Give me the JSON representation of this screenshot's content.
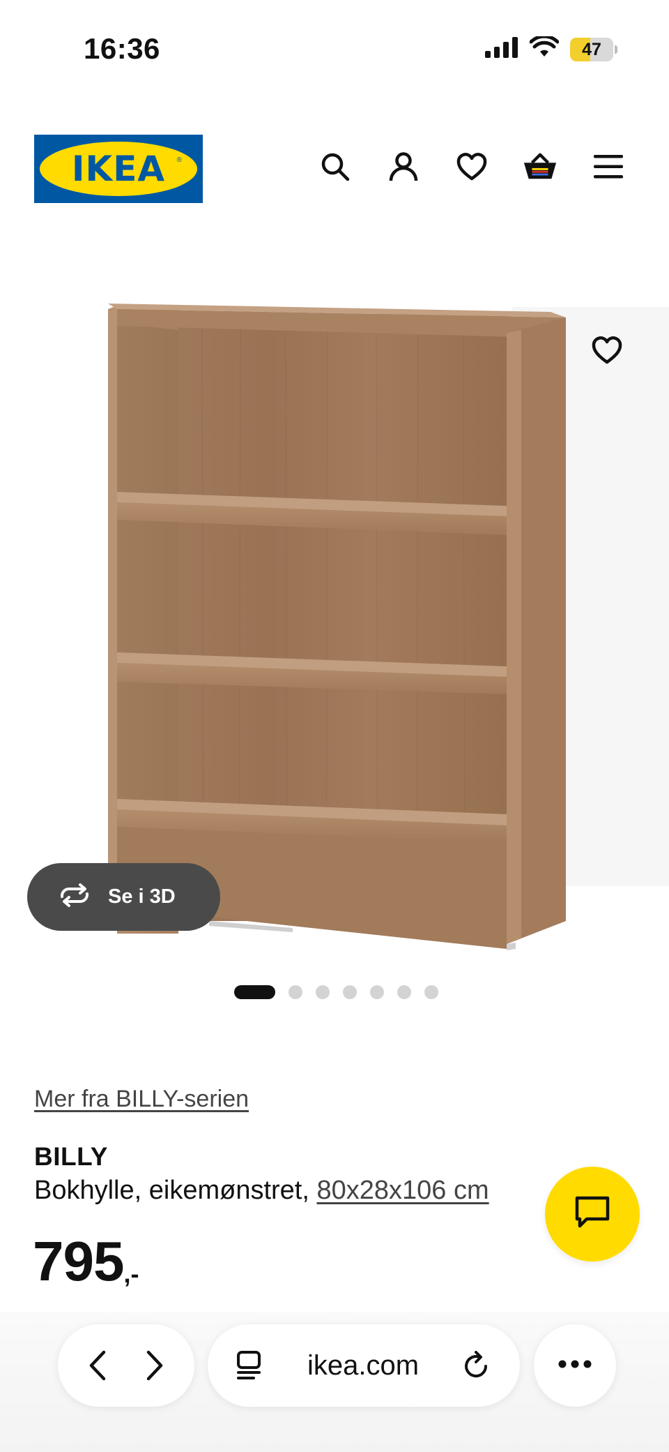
{
  "status_bar": {
    "time": "16:36",
    "battery_level": "47",
    "battery_color": "#f2cf2c",
    "icons": [
      "cellular-signal-icon",
      "wifi-icon",
      "battery-icon"
    ]
  },
  "header": {
    "logo_text": "IKEA",
    "logo_colors": {
      "blue": "#0058a3",
      "yellow": "#ffdb00"
    },
    "icons": [
      "search-icon",
      "account-icon",
      "heart-icon",
      "basket-icon",
      "menu-icon"
    ]
  },
  "gallery": {
    "view_3d_label": "Se i 3D",
    "image_count": 7,
    "active_index": 0
  },
  "product": {
    "series_link": "Mer fra BILLY-serien",
    "name": "BILLY",
    "description": "Bokhylle, eikemønstret,",
    "size": "80x28x106 cm",
    "price": "795",
    "price_suffix": ",-"
  },
  "chat": {
    "icon": "chat-icon",
    "color": "#ffdb00"
  },
  "browser": {
    "url": "ikea.com",
    "icons": [
      "back-icon",
      "forward-icon",
      "tabs-icon",
      "reload-icon",
      "more-icon"
    ]
  }
}
